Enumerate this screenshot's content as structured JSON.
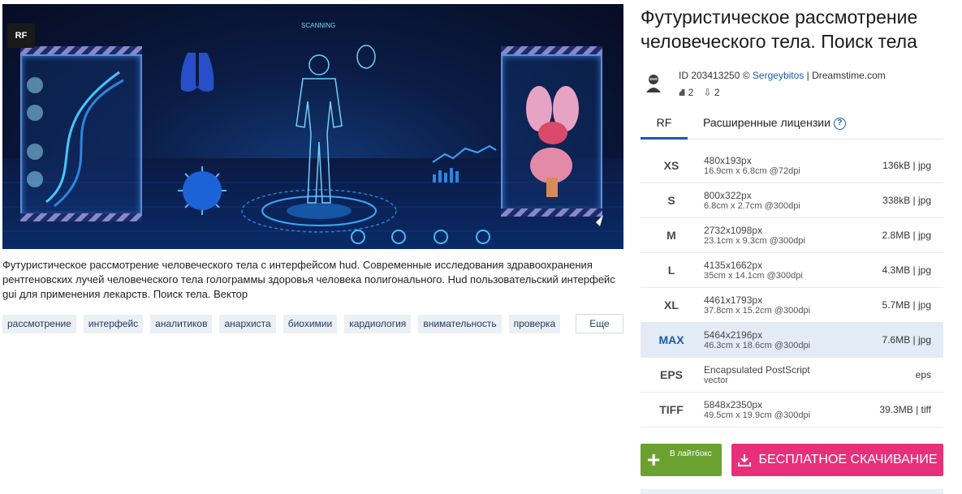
{
  "image": {
    "badge": "RF",
    "caption": "Футуристическое рассмотрение человеческого тела с интерфейсом hud. Современные исследования здравоохранения рентгеновских лучей человеческого тела голограммы здоровья человека полигонального. Hud пользовательский интерфейс gui для применения лекарств. Поиск тела. Вектор"
  },
  "tags": [
    "рассмотрение",
    "интерфейс",
    "аналитиков",
    "анархиста",
    "биохимии",
    "кардиология",
    "внимательность",
    "проверка"
  ],
  "more_label": "Еще",
  "title": "Футуристическое рассмотрение человеческого тела. Поиск тела",
  "meta": {
    "id_text": "ID 203413250 ©",
    "author": "Sergeybitos",
    "source": "| Dreamstime.com",
    "stat_1": "2",
    "stat_2": "2"
  },
  "tabs": {
    "rf": "RF",
    "extended": "Расширенные лицензии",
    "help": "?"
  },
  "sizes": [
    {
      "code": "XS",
      "dims": "480x193px",
      "physical": "16.9cm x 6.8cm @72dpi",
      "file": "136kB | jpg"
    },
    {
      "code": "S",
      "dims": "800x322px",
      "physical": "6.8cm x 2.7cm @300dpi",
      "file": "338kB | jpg"
    },
    {
      "code": "M",
      "dims": "2732x1098px",
      "physical": "23.1cm x 9.3cm @300dpi",
      "file": "2.8MB | jpg"
    },
    {
      "code": "L",
      "dims": "4135x1662px",
      "physical": "35cm x 14.1cm @300dpi",
      "file": "4.3MB | jpg"
    },
    {
      "code": "XL",
      "dims": "4461x1793px",
      "physical": "37.8cm x 15.2cm @300dpi",
      "file": "5.7MB | jpg"
    },
    {
      "code": "MAX",
      "dims": "5464x2196px",
      "physical": "46.3cm x 18.6cm @300dpi",
      "file": "7.6MB | jpg"
    },
    {
      "code": "EPS",
      "dims": "Encapsulated PostScript",
      "physical": "vector",
      "file": "eps"
    },
    {
      "code": "TIFF",
      "dims": "5848x2350px",
      "physical": "49.5cm x 19.9cm @300dpi",
      "file": "39.3MB | tiff"
    }
  ],
  "actions": {
    "lightbox": "В лайтбокс",
    "download": "БЕСПЛАТНОЕ СКАЧИВАНИЕ"
  },
  "colors": {
    "accent": "#1a5aa8",
    "download": "#e8307a",
    "lightbox": "#6aa12f",
    "selected_row": "#e3ebf7"
  }
}
